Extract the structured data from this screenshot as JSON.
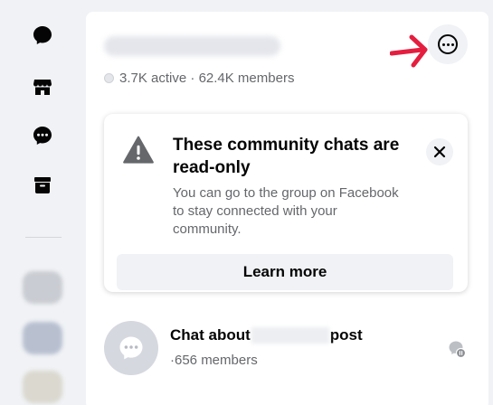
{
  "left_rail": {
    "icons": [
      "chat-bubble-icon",
      "marketplace-icon",
      "requests-icon",
      "archive-icon"
    ],
    "icon_color": "#050505"
  },
  "group": {
    "active_count": "3.7K active",
    "separator": " · ",
    "member_count": "62.4K members"
  },
  "notice": {
    "title": "These community chats are read-only",
    "body": "You can go to the group on Facebook to stay connected with your community.",
    "button_label": "Learn more"
  },
  "chat": {
    "title_prefix": "Chat about",
    "title_suffix": "post",
    "members": "·656 members"
  },
  "colors": {
    "annotation_arrow": "#e41e3f",
    "secondary_text": "#65676b"
  }
}
